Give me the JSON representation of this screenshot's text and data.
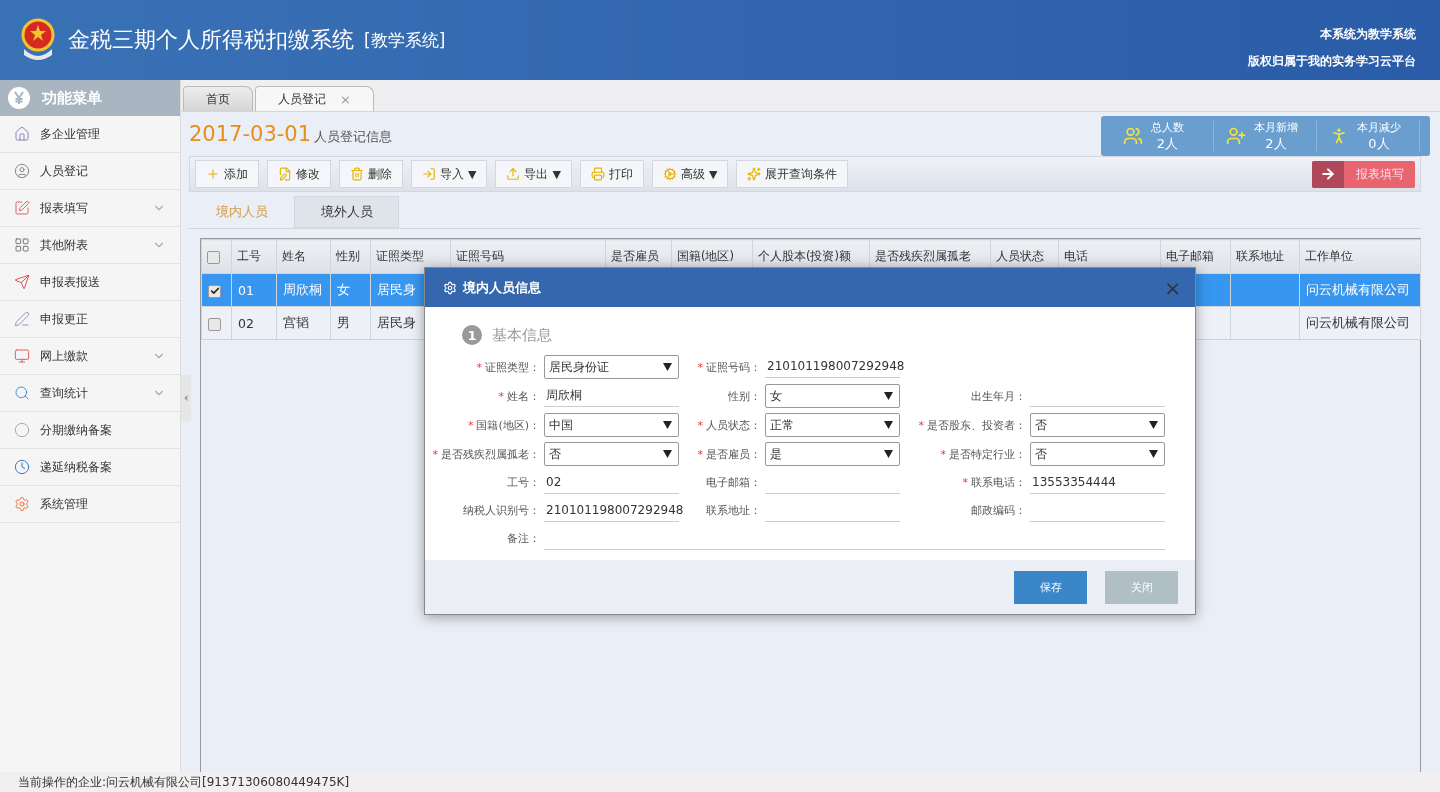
{
  "header": {
    "title": "金税三期个人所得税扣缴系统",
    "subtitle": "[教学系统]",
    "notes": [
      "本系统为教学系统",
      "版权归属于我的实务学习云平台"
    ]
  },
  "sidebar": {
    "title": "功能菜单",
    "items": [
      {
        "label": "多企业管理",
        "submenu": false
      },
      {
        "label": "人员登记",
        "submenu": false
      },
      {
        "label": "报表填写",
        "submenu": true
      },
      {
        "label": "其他附表",
        "submenu": true
      },
      {
        "label": "申报表报送",
        "submenu": false
      },
      {
        "label": "申报更正",
        "submenu": false
      },
      {
        "label": "网上缴款",
        "submenu": true
      },
      {
        "label": "查询统计",
        "submenu": true
      },
      {
        "label": "分期缴纳备案",
        "submenu": false
      },
      {
        "label": "递延纳税备案",
        "submenu": false
      },
      {
        "label": "系统管理",
        "submenu": false
      }
    ]
  },
  "page_tabs": [
    {
      "label": "首页",
      "selected": false,
      "closable": false
    },
    {
      "label": "人员登记",
      "selected": true,
      "closable": true,
      "close": "×"
    }
  ],
  "page_title": {
    "date": "2017-03-01",
    "caption": "人员登记信息"
  },
  "stats": [
    {
      "label": "总人数",
      "value": "2人"
    },
    {
      "label": "本月新增",
      "value": "2人"
    },
    {
      "label": "本月减少",
      "value": "0人"
    }
  ],
  "toolbar": [
    {
      "label": "添加"
    },
    {
      "label": "修改"
    },
    {
      "label": "删除"
    },
    {
      "label": "导入",
      "caret": "▼"
    },
    {
      "label": "导出",
      "caret": "▼"
    },
    {
      "label": "打印"
    },
    {
      "label": "高级",
      "caret": "▼"
    },
    {
      "label": "展开查询条件"
    }
  ],
  "report_button": {
    "label": "报表填写"
  },
  "sub_tabs": [
    {
      "label": "境内人员",
      "selected": true
    },
    {
      "label": "境外人员",
      "selected": false
    }
  ],
  "table": {
    "header_checked": false,
    "columns": [
      "工号",
      "姓名",
      "性别",
      "证照类型",
      "证照号码",
      "是否雇员",
      "国籍(地区)",
      "个人股本(投资)额",
      "是否残疾烈属孤老",
      "人员状态",
      "电话",
      "电子邮箱",
      "联系地址",
      "工作单位"
    ],
    "rows": [
      {
        "selected": true,
        "checked": true,
        "cells": [
          "01",
          "周欣桐",
          "女",
          "居民身",
          "",
          "",
          "",
          "",
          "",
          "",
          "",
          "",
          "",
          "问云机械有限公司"
        ]
      },
      {
        "selected": false,
        "checked": false,
        "cells": [
          "02",
          "宫韬",
          "男",
          "居民身",
          "",
          "",
          "",
          "",
          "",
          "",
          "",
          "",
          "",
          "问云机械有限公司"
        ]
      }
    ]
  },
  "status_bar": "当前操作的企业:问云机械有限公司[91371306080449475K]",
  "dialog": {
    "title": "境内人员信息",
    "close": "×",
    "section": {
      "step": "1",
      "title": "基本信息"
    },
    "rows": [
      [
        {
          "label": "证照类型：",
          "mark": "*",
          "kind": "select",
          "value": "居民身份证"
        },
        {
          "label": "证照号码：",
          "mark": "*",
          "kind": "text",
          "value": "210101198007292948"
        }
      ],
      [
        {
          "label": "姓名：",
          "mark": "*",
          "kind": "text",
          "value": "周欣桐"
        },
        {
          "label": "性别：",
          "kind": "select",
          "value": "女"
        },
        {
          "label": "出生年月：",
          "kind": "text"
        }
      ],
      [
        {
          "label": "国籍(地区)：",
          "mark": "*",
          "kind": "select",
          "value": "中国"
        },
        {
          "label": "人员状态：",
          "mark": "*",
          "kind": "select",
          "value": "正常"
        },
        {
          "label": "是否股东、投资者：",
          "mark": "*",
          "kind": "select",
          "value": "否"
        }
      ],
      [
        {
          "label": "是否残疾烈属孤老：",
          "mark": "*",
          "kind": "select",
          "value": "否"
        },
        {
          "label": "是否雇员：",
          "mark": "*",
          "kind": "select",
          "value": "是"
        },
        {
          "label": "是否特定行业：",
          "mark": "*",
          "kind": "select",
          "value": "否"
        }
      ],
      [
        {
          "label": "工号：",
          "kind": "text",
          "value": "02"
        },
        {
          "label": "电子邮箱：",
          "kind": "text"
        },
        {
          "label": "联系电话：",
          "mark": "*",
          "kind": "text",
          "value": "13553354444"
        }
      ],
      [
        {
          "label": "纳税人识别号：",
          "kind": "text",
          "value": "210101198007292948"
        },
        {
          "label": "联系地址：",
          "kind": "text"
        },
        {
          "label": "邮政编码：",
          "kind": "text"
        }
      ],
      [
        {
          "label": "备注：",
          "kind": "wide"
        }
      ]
    ],
    "buttons": [
      {
        "label": "保存",
        "kind": "primary"
      },
      {
        "label": "关闭",
        "kind": "secondary"
      }
    ]
  }
}
